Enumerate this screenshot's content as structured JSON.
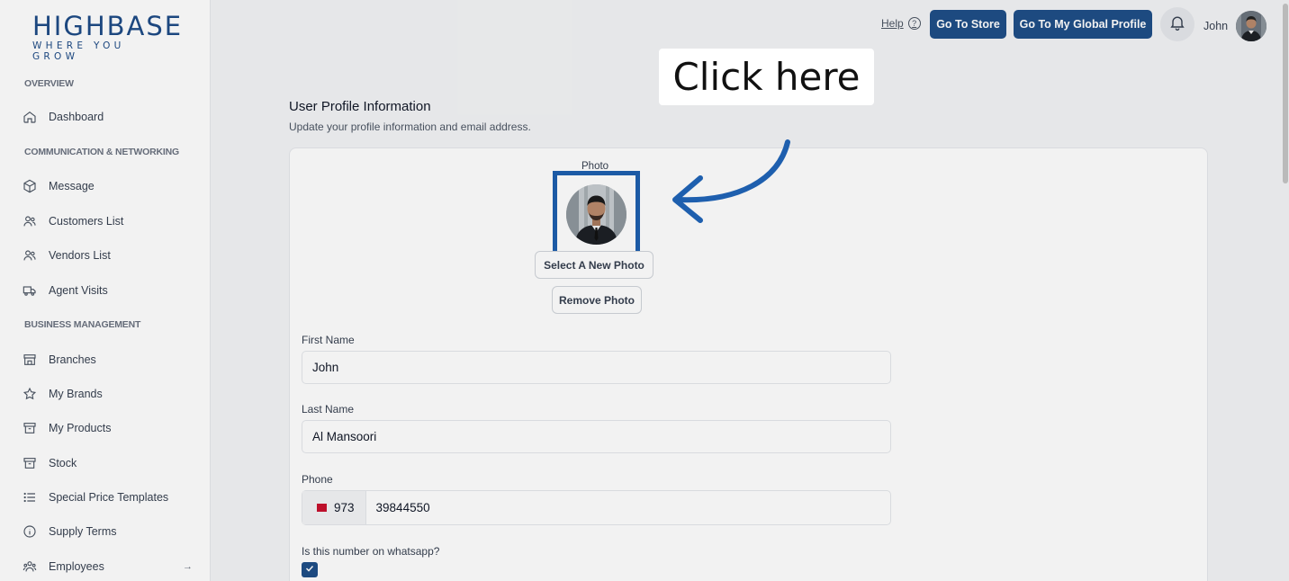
{
  "logo": {
    "main": "HIGHBASE",
    "tagline": "WHERE YOU GROW"
  },
  "sidebar": {
    "sections": [
      {
        "label": "OVERVIEW"
      },
      {
        "label": "COMMUNICATION & NETWORKING"
      },
      {
        "label": "BUSINESS MANAGEMENT"
      }
    ],
    "items": [
      {
        "label": "Dashboard",
        "icon": "home-icon"
      },
      {
        "label": "Message",
        "icon": "cube-icon"
      },
      {
        "label": "Customers List",
        "icon": "users-icon"
      },
      {
        "label": "Vendors List",
        "icon": "users-icon"
      },
      {
        "label": "Agent Visits",
        "icon": "truck-icon"
      },
      {
        "label": "Branches",
        "icon": "store-icon"
      },
      {
        "label": "My Brands",
        "icon": "star-icon"
      },
      {
        "label": "My Products",
        "icon": "archive-icon"
      },
      {
        "label": "Stock",
        "icon": "archive-icon"
      },
      {
        "label": "Special Price Templates",
        "icon": "list-icon"
      },
      {
        "label": "Supply Terms",
        "icon": "info-icon"
      },
      {
        "label": "Employees",
        "icon": "users-icon",
        "arrow": "→"
      }
    ]
  },
  "topbar": {
    "help_label": "Help",
    "help_icon": "?",
    "store_button": "Go To Store",
    "global_profile_button": "Go To My Global Profile",
    "user_name": "John"
  },
  "page": {
    "title": "User Profile Information",
    "description": "Update your profile information and email address."
  },
  "form": {
    "photo_label": "Photo",
    "select_photo_button": "Select A New Photo",
    "remove_photo_button": "Remove Photo",
    "first_name_label": "First Name",
    "first_name_value": "John",
    "last_name_label": "Last Name",
    "last_name_value": "Al Mansoori",
    "phone_label": "Phone",
    "phone_code": "973",
    "phone_value": "39844550",
    "whatsapp_label": "Is this number on whatsapp?",
    "whatsapp_checked": true
  },
  "overlay": {
    "callout_text": "Click here"
  },
  "colors": {
    "brand": "#1f4e87",
    "highlight": "#1e5fae"
  }
}
